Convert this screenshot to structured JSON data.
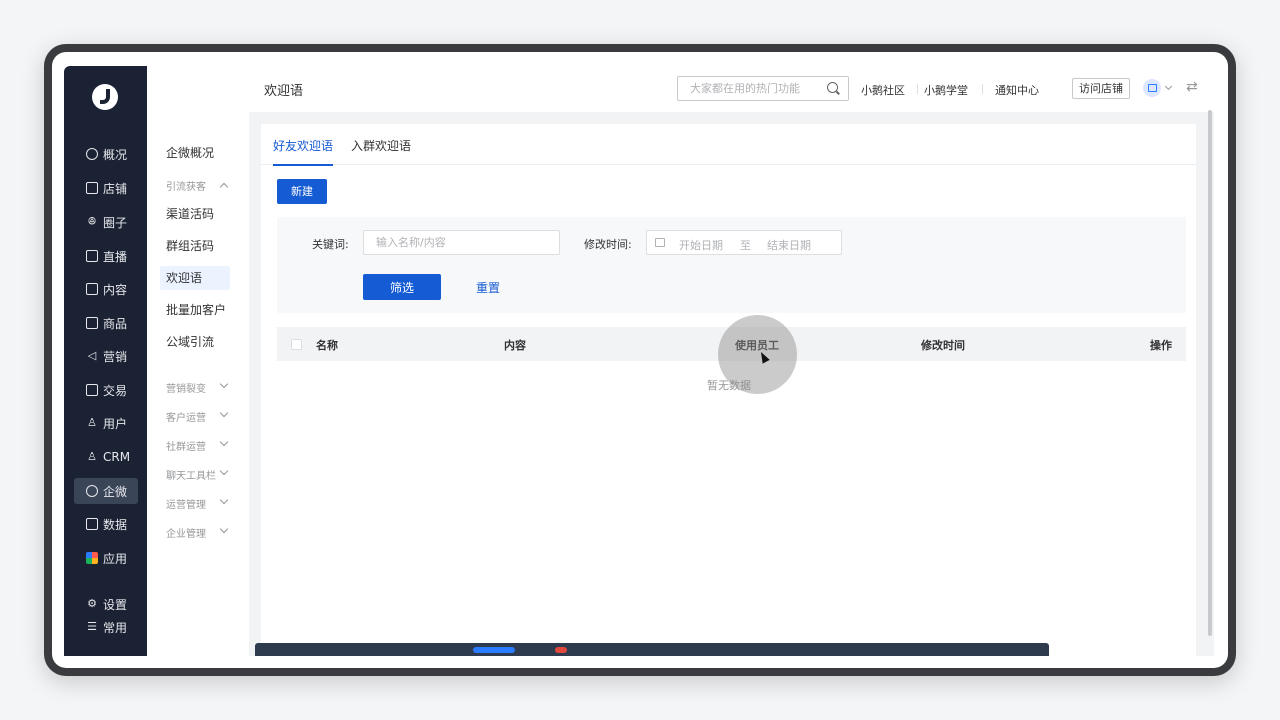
{
  "nav": {
    "items": [
      {
        "label": "概况",
        "icon": "pie-chart-icon"
      },
      {
        "label": "店铺",
        "icon": "store-icon"
      },
      {
        "label": "圈子",
        "icon": "group-icon"
      },
      {
        "label": "直播",
        "icon": "live-icon"
      },
      {
        "label": "内容",
        "icon": "content-icon"
      },
      {
        "label": "商品",
        "icon": "product-icon"
      },
      {
        "label": "营销",
        "icon": "megaphone-icon"
      },
      {
        "label": "交易",
        "icon": "trade-icon"
      },
      {
        "label": "用户",
        "icon": "user-icon"
      },
      {
        "label": "CRM",
        "icon": "crm-icon"
      },
      {
        "label": "企微",
        "icon": "wecom-icon",
        "active": true
      },
      {
        "label": "数据",
        "icon": "data-icon"
      },
      {
        "label": "应用",
        "icon": "apps-icon"
      },
      {
        "label": "设置",
        "icon": "settings-icon"
      },
      {
        "label": "常用",
        "icon": "list-icon"
      }
    ]
  },
  "subnav": {
    "overview": "企微概况",
    "groups": {
      "traffic": "引流获客",
      "marketing": "营销裂变",
      "customer_ops": "客户运营",
      "community_ops": "社群运营",
      "chat_tools": "聊天工具栏",
      "ops_mgmt": "运营管理",
      "enterprise_mgmt": "企业管理"
    },
    "traffic_items": [
      "渠道活码",
      "群组活码",
      "欢迎语",
      "批量加客户",
      "公域引流"
    ],
    "active_item": "欢迎语"
  },
  "header": {
    "title": "欢迎语",
    "search_placeholder": "大家都在用的热门功能",
    "links": [
      "小鹅社区",
      "小鹅学堂",
      "通知中心"
    ],
    "visit_store": "访问店铺"
  },
  "content": {
    "tabs": [
      "好友欢迎语",
      "入群欢迎语"
    ],
    "active_tab": "好友欢迎语",
    "new_button": "新建",
    "filter": {
      "keyword_label": "关键词:",
      "keyword_placeholder": "输入名称/内容",
      "time_label": "修改时间:",
      "start_placeholder": "开始日期",
      "range_sep": "至",
      "end_placeholder": "结束日期",
      "filter_button": "筛选",
      "reset_button": "重置"
    },
    "table": {
      "columns": [
        "名称",
        "内容",
        "使用员工",
        "修改时间",
        "操作"
      ],
      "empty_text": "暂无数据"
    }
  },
  "colors": {
    "primary": "#155bd4",
    "nav_bg": "#1b2233",
    "nav_active": "#3b4558"
  }
}
